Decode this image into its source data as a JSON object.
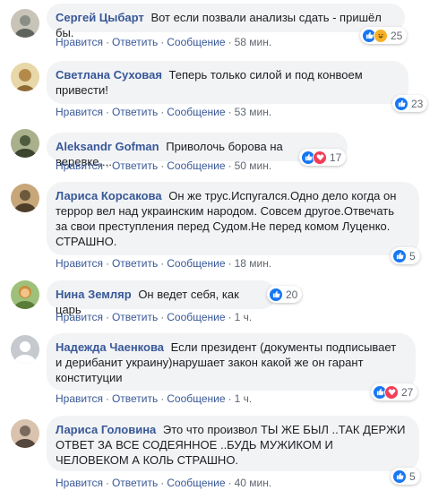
{
  "actions": {
    "like": "Нравится",
    "reply": "Ответить",
    "message": "Сообщение",
    "separator": "·"
  },
  "comments": [
    {
      "author": "Сергей Цыбарт",
      "text": "Вот если позвали анализы сдать - пришёл бы.",
      "time": "58 мин.",
      "reactions": [
        "like",
        "haha"
      ],
      "count": "25",
      "avatar_colors": [
        "#8a8f86",
        "#c9c4b8"
      ]
    },
    {
      "author": "Светлана Суховая",
      "text": "Теперь только силой и под конвоем привести!",
      "time": "53 мин.",
      "reactions": [
        "like"
      ],
      "count": "23",
      "avatar_colors": [
        "#b48a4a",
        "#e8d7a8"
      ]
    },
    {
      "author": "Aleksandr Gofman",
      "text": "Приволочь борова на веревке....",
      "time": "50 мин.",
      "reactions": [
        "like",
        "love"
      ],
      "count": "17",
      "avatar_colors": [
        "#4f5b3e",
        "#a9b08c"
      ]
    },
    {
      "author": "Лариса Корсакова",
      "text": "Он же трус.Испугался.Одно дело когда он террор вел над украинским народом. Совсем другое.Отвечать за свои преступления перед Судом.Не перед комом Луценко. СТРАШНО.",
      "time": "18 мин.",
      "reactions": [
        "like"
      ],
      "count": "5",
      "avatar_colors": [
        "#6d5a3c",
        "#c7a77a"
      ]
    },
    {
      "author": "Нина Земляр",
      "text": "Он ведет себя, как царь",
      "time": "1 ч.",
      "reactions": [
        "like"
      ],
      "count": "20",
      "avatar_colors": [
        "#c98d3a",
        "#f2c48a"
      ]
    },
    {
      "author": "Надежда Чаенкова",
      "text": "Если президент (документы подписывает и дерибанит украину)нарушает закон какой же он гарант конституции",
      "time": "1 ч.",
      "reactions": [
        "like",
        "love"
      ],
      "count": "27",
      "avatar_colors": [
        "#c6c9ce",
        "#ffffff"
      ]
    },
    {
      "author": "Лариса Головина",
      "text": "Это что произвол ТЫ ЖЕ БЫЛ ..ТАК ДЕРЖИ ОТВЕТ ЗА ВСЕ СОДЕЯННОЕ ..БУДЬ МУЖИКОМ И ЧЕЛОВЕКОМ А КОЛЬ СТРАШНО.",
      "time": "40 мин.",
      "reactions": [
        "like"
      ],
      "count": "5",
      "avatar_colors": [
        "#7a6a5e",
        "#d9c2ae"
      ]
    }
  ]
}
